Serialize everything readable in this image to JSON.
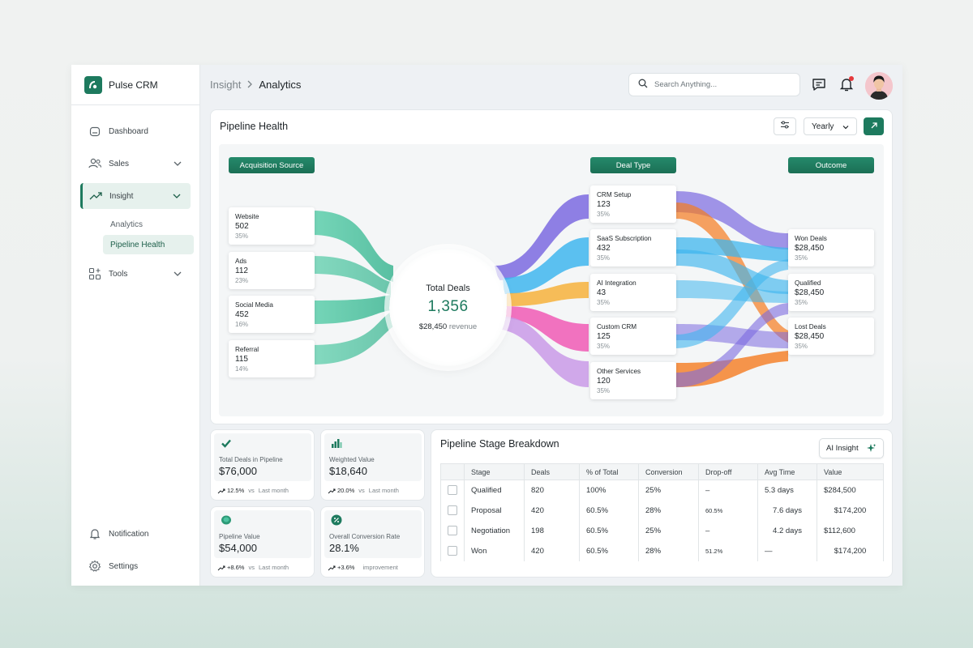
{
  "brand": {
    "name": "Pulse CRM"
  },
  "sidebar": {
    "items": [
      {
        "label": "Dashboard"
      },
      {
        "label": "Sales"
      },
      {
        "label": "Insight"
      },
      {
        "label": "Tools"
      }
    ],
    "sub_items": [
      {
        "label": "Analytics"
      },
      {
        "label": "Pipeline Health"
      }
    ],
    "bottom": [
      {
        "label": "Notification"
      },
      {
        "label": "Settings"
      }
    ]
  },
  "header": {
    "breadcrumb": [
      "Insight",
      "Analytics"
    ],
    "search_placeholder": "Search Anything..."
  },
  "pipeline": {
    "title": "Pipeline Health",
    "period": "Yearly",
    "columns": [
      "Acquisition Source",
      "Deal Type",
      "Outcome"
    ],
    "sources": [
      {
        "label": "Website",
        "value": "502",
        "pct": "35%"
      },
      {
        "label": "Ads",
        "value": "112",
        "pct": "23%"
      },
      {
        "label": "Social Media",
        "value": "452",
        "pct": "16%"
      },
      {
        "label": "Referral",
        "value": "115",
        "pct": "14%"
      }
    ],
    "center": {
      "title": "Total Deals",
      "value": "1,356",
      "revenue": "$28,450",
      "revenue_label": "revenue"
    },
    "deal_types": [
      {
        "label": "CRM Setup",
        "value": "123",
        "pct": "35%"
      },
      {
        "label": "SaaS Subscription",
        "value": "432",
        "pct": "35%"
      },
      {
        "label": "AI Integration",
        "value": "43",
        "pct": "35%"
      },
      {
        "label": "Custom CRM",
        "value": "125",
        "pct": "35%"
      },
      {
        "label": "Other Services",
        "value": "120",
        "pct": "35%"
      }
    ],
    "outcomes": [
      {
        "label": "Won Deals",
        "value": "$28,450",
        "pct": "35%"
      },
      {
        "label": "Qualified",
        "value": "$28,450",
        "pct": "35%"
      },
      {
        "label": "Lost Deals",
        "value": "$28,450",
        "pct": "35%"
      }
    ],
    "colors": {
      "source_flow": "#4cc3a0",
      "crm_setup": "#7b6ae0",
      "saas": "#3fb6ee",
      "ai": "#f6b23c",
      "custom": "#f05bb5",
      "other": "#c99ae8",
      "lost": "#f57c1f"
    }
  },
  "stats": [
    {
      "label": "Total Deals in Pipeline",
      "value": "$76,000",
      "change": "12.5%",
      "vs": "vs",
      "compare": "Last month",
      "icon": "check-icon"
    },
    {
      "label": "Weighted Value",
      "value": "$18,640",
      "change": "20.0%",
      "vs": "vs",
      "compare": "Last month",
      "icon": "bar-chart-icon"
    },
    {
      "label": "Pipeline Value",
      "value": "$54,000",
      "change": "+8.6%",
      "vs": "vs",
      "compare": "Last month",
      "icon": "leaf-icon"
    },
    {
      "label": "Overall Conversion Rate",
      "value": "28.1%",
      "change": "+3.6%",
      "vs": "",
      "compare": "improvement",
      "icon": "percent-icon"
    }
  ],
  "breakdown": {
    "title": "Pipeline Stage Breakdown",
    "ai_label": "AI Insight",
    "headers": [
      "Stage",
      "Deals",
      "% of Total",
      "Conversion",
      "Drop-off",
      "Avg Time",
      "Value"
    ],
    "rows": [
      [
        "Qualified",
        "820",
        "100%",
        "25%",
        "–",
        "5.3 days",
        "$284,500"
      ],
      [
        "Proposal",
        "420",
        "60.5%",
        "28%",
        "60.5%",
        "7.6 days",
        "$174,200"
      ],
      [
        "Negotiation",
        "198",
        "60.5%",
        "25%",
        "–",
        "4.2 days",
        "$112,600"
      ],
      [
        "Won",
        "420",
        "60.5%",
        "28%",
        "51.2%",
        "—",
        "$174,200"
      ]
    ]
  }
}
